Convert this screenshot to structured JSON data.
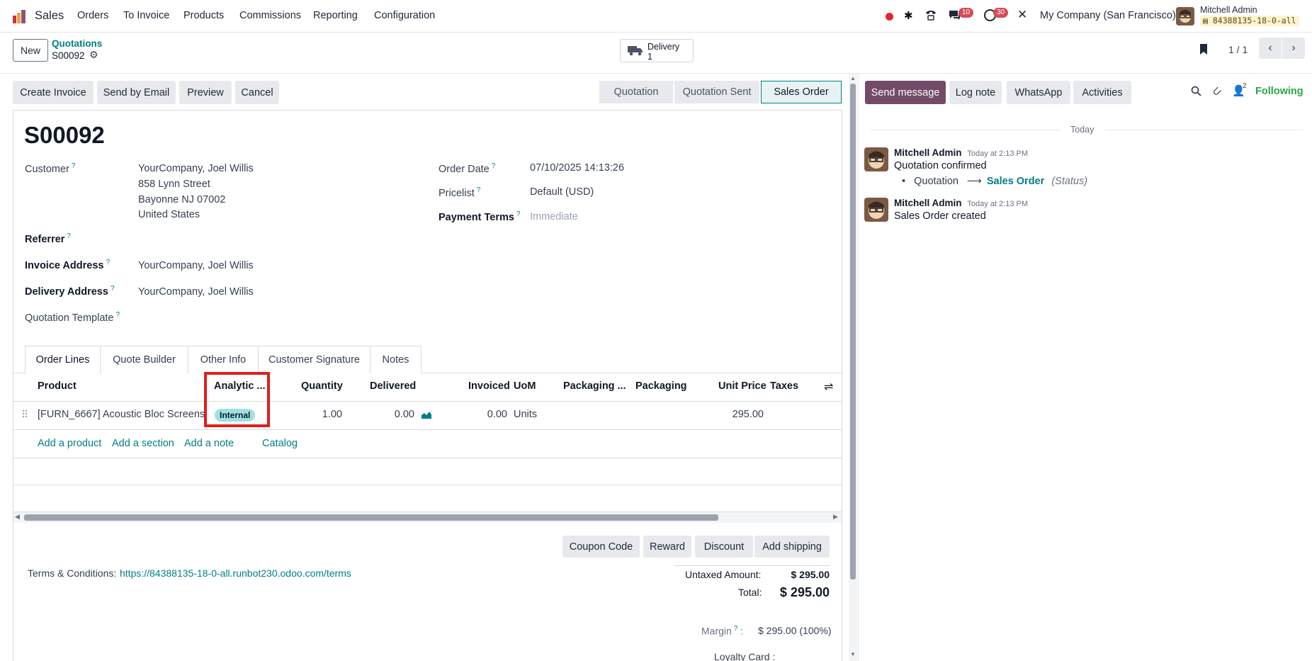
{
  "navbar": {
    "app_name": "Sales",
    "menu": [
      "Orders",
      "To Invoice",
      "Products",
      "Commissions",
      "Reporting",
      "Configuration"
    ],
    "messages_count": "10",
    "activities_count": "30",
    "company": "My Company (San Francisco)",
    "user_name": "Mitchell Admin",
    "db_name": "84388135-18-0-all"
  },
  "control": {
    "new_label": "New",
    "breadcrumb_parent": "Quotations",
    "record_name": "S00092",
    "smart_button_label": "Delivery",
    "smart_button_count": "1",
    "pager": "1 / 1"
  },
  "actions": [
    "Create Invoice",
    "Send by Email",
    "Preview",
    "Cancel"
  ],
  "stages": [
    "Quotation",
    "Quotation Sent",
    "Sales Order"
  ],
  "form": {
    "title": "S00092",
    "customer_label": "Customer",
    "customer_name": "YourCompany, Joel Willis",
    "customer_address": [
      "858 Lynn Street",
      "Bayonne NJ 07002",
      "United States"
    ],
    "referrer_label": "Referrer",
    "invoice_address_label": "Invoice Address",
    "invoice_address": "YourCompany, Joel Willis",
    "delivery_address_label": "Delivery Address",
    "delivery_address": "YourCompany, Joel Willis",
    "quotation_template_label": "Quotation Template",
    "order_date_label": "Order Date",
    "order_date": "07/10/2025 14:13:26",
    "pricelist_label": "Pricelist",
    "pricelist": "Default (USD)",
    "payment_terms_label": "Payment Terms",
    "payment_terms": "Immediate"
  },
  "tabs": [
    "Order Lines",
    "Quote Builder",
    "Other Info",
    "Customer Signature",
    "Notes"
  ],
  "table": {
    "headers": [
      "Product",
      "Analytic ...",
      "Quantity",
      "Delivered",
      "Invoiced",
      "UoM",
      "Packaging ...",
      "Packaging",
      "Unit Price",
      "Taxes"
    ],
    "row": {
      "product": "[FURN_6667] Acoustic Bloc Screens...",
      "analytic": "Internal",
      "quantity": "1.00",
      "delivered": "0.00",
      "invoiced": "0.00",
      "uom": "Units",
      "unit_price": "295.00"
    },
    "add_product": "Add a product",
    "add_section": "Add a section",
    "add_note": "Add a note",
    "catalog": "Catalog"
  },
  "extra_buttons": [
    "Coupon Code",
    "Reward",
    "Discount",
    "Add shipping"
  ],
  "terms": {
    "label": "Terms & Conditions:",
    "url": "https://84388135-18-0-all.runbot230.odoo.com/terms"
  },
  "totals": {
    "untaxed_label": "Untaxed Amount:",
    "untaxed": "$ 295.00",
    "total_label": "Total:",
    "total": "$ 295.00",
    "margin_label": "Margin",
    "margin": "$ 295.00 (100%)",
    "loyalty_label": "Loyalty Card :"
  },
  "chatter": {
    "send_message": "Send message",
    "log_note": "Log note",
    "whatsapp": "WhatsApp",
    "activities": "Activities",
    "followers_count": "2",
    "following": "Following",
    "date_separator": "Today",
    "messages": [
      {
        "author": "Mitchell Admin",
        "time": "Today at 2:13 PM",
        "body": "Quotation confirmed",
        "from_status": "Quotation",
        "to_status": "Sales Order",
        "field": "(Status)"
      },
      {
        "author": "Mitchell Admin",
        "time": "Today at 2:13 PM",
        "body": "Sales Order created"
      }
    ]
  },
  "colors": {
    "brand": "#714b67",
    "link": "#017e84",
    "highlight": "#e11d1d",
    "tag": "#9ee1e3"
  }
}
